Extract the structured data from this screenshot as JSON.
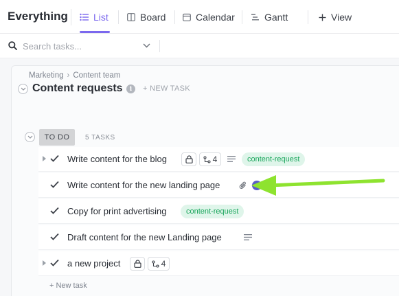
{
  "header": {
    "title": "Everything",
    "tabs": [
      {
        "label": "List",
        "icon": "list-icon",
        "active": true
      },
      {
        "label": "Board",
        "icon": "board-icon",
        "active": false
      },
      {
        "label": "Calendar",
        "icon": "calendar-icon",
        "active": false
      },
      {
        "label": "Gantt",
        "icon": "gantt-icon",
        "active": false
      }
    ],
    "add_view_label": "View"
  },
  "search": {
    "placeholder": "Search tasks..."
  },
  "list": {
    "breadcrumb": [
      "Marketing",
      "Content team"
    ],
    "title": "Content requests",
    "new_task_label": "+ NEW TASK"
  },
  "group": {
    "status": "TO DO",
    "count_label": "5 TASKS"
  },
  "tasks": [
    {
      "name": "Write content for the blog",
      "subtasks": "4",
      "tag": "content-request"
    },
    {
      "name": "Write content for the new landing page"
    },
    {
      "name": "Copy for print advertising",
      "tag": "content-request"
    },
    {
      "name": "Draft content for the new Landing page"
    },
    {
      "name": "a new project",
      "subtasks": "4"
    }
  ],
  "footer": {
    "new_task_label": "+ New task"
  },
  "colors": {
    "accent": "#7b68ee",
    "tag_bg": "#dff5ea",
    "tag_text": "#18a55a",
    "annotation_arrow": "#8ee32f"
  }
}
